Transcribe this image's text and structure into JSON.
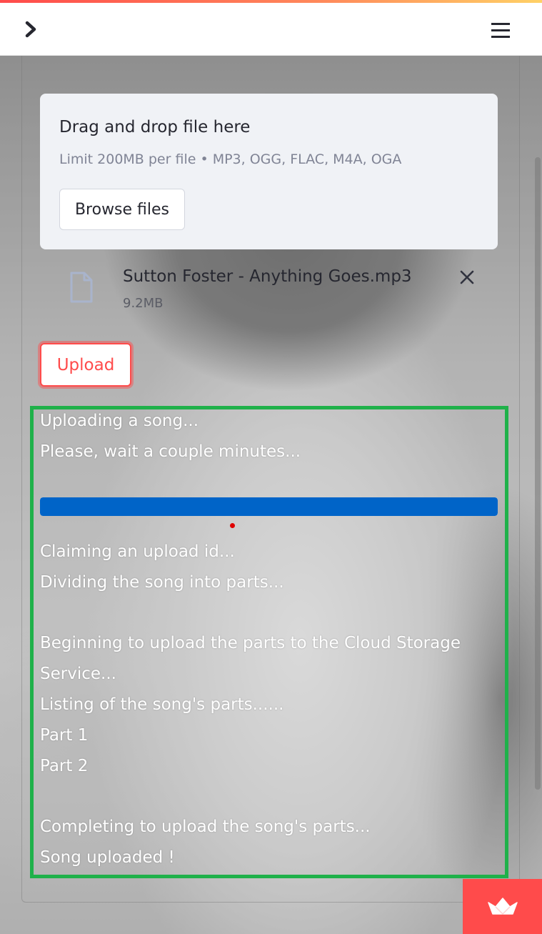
{
  "header": {
    "sidebar_toggle_icon": "chevron-right-icon",
    "menu_icon": "hamburger-menu-icon"
  },
  "uploader": {
    "title": "Drag and drop file here",
    "limit": "Limit 200MB per file • MP3, OGG, FLAC, M4A, OGA",
    "browse_label": "Browse files"
  },
  "file": {
    "name": "Sutton Foster - Anything Goes.mp3",
    "size": "9.2MB",
    "icon": "file-icon",
    "remove_icon": "close-icon"
  },
  "upload_label": "Upload",
  "progress": {
    "value": 1.0,
    "color": "#0064c8"
  },
  "log": {
    "line1": "Uploading a song...",
    "line2": "Please, wait a couple minutes...",
    "line3": "Claiming an upload id...",
    "line4": "Dividing the song into parts...",
    "line5": "Beginning to upload the parts to the Cloud Storage",
    "line6": "Service...",
    "line7": "Listing of the song's parts......",
    "line8": "Part 1",
    "line9": "Part 2",
    "line10": "Completing to upload the song's parts...",
    "line11": "Song uploaded !"
  },
  "colors": {
    "accent": "#ff4b4b",
    "highlight_box": "#1fb14a",
    "progress": "#0064c8"
  },
  "badge_icon": "streamlit-crown-icon"
}
